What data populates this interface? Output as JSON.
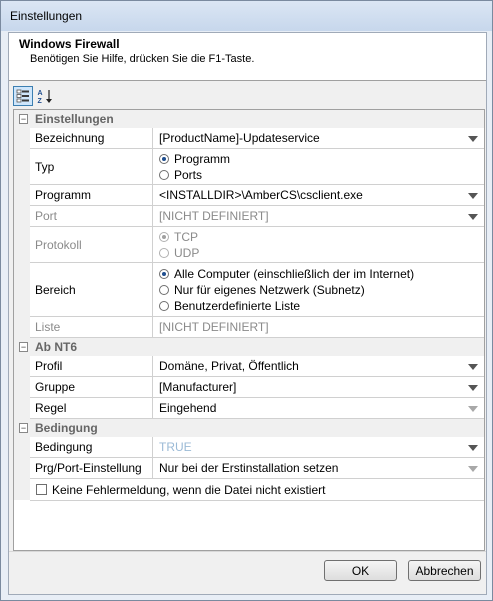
{
  "window": {
    "title": "Einstellungen"
  },
  "header": {
    "title": "Windows Firewall",
    "subtitle": "Benötigen Sie Hilfe, drücken Sie die F1-Taste."
  },
  "toolbar": {
    "categorized_icon": "categorized-view-icon",
    "alphabetical_icon": "sort-alphabetical-icon"
  },
  "grid": {
    "cat1": "Einstellungen",
    "bezeichnung": {
      "label": "Bezeichnung",
      "value": "[ProductName]-Updateservice"
    },
    "typ": {
      "label": "Typ",
      "opt1": "Programm",
      "opt2": "Ports"
    },
    "programm": {
      "label": "Programm",
      "value": "<INSTALLDIR>\\AmberCS\\csclient.exe"
    },
    "port": {
      "label": "Port",
      "value": "[NICHT DEFINIERT]"
    },
    "protokoll": {
      "label": "Protokoll",
      "opt1": "TCP",
      "opt2": "UDP"
    },
    "bereich": {
      "label": "Bereich",
      "opt1": "Alle Computer (einschließlich der im Internet)",
      "opt2": "Nur für eigenes Netzwerk (Subnetz)",
      "opt3": "Benutzerdefinierte Liste"
    },
    "liste": {
      "label": "Liste",
      "value": "[NICHT DEFINIERT]"
    },
    "cat2": "Ab NT6",
    "profil": {
      "label": "Profil",
      "value": "Domäne, Privat, Öffentlich"
    },
    "gruppe": {
      "label": "Gruppe",
      "value": "[Manufacturer]"
    },
    "regel": {
      "label": "Regel",
      "value": "Eingehend"
    },
    "cat3": "Bedingung",
    "bedingung": {
      "label": "Bedingung",
      "value": "TRUE"
    },
    "prgport": {
      "label": "Prg/Port-Einstellung",
      "value": "Nur bei der Erstinstallation setzen"
    },
    "checkbox": {
      "label": "Keine Fehlermeldung, wenn die Datei nicht existiert"
    }
  },
  "buttons": {
    "ok": "OK",
    "cancel": "Abbrechen"
  }
}
